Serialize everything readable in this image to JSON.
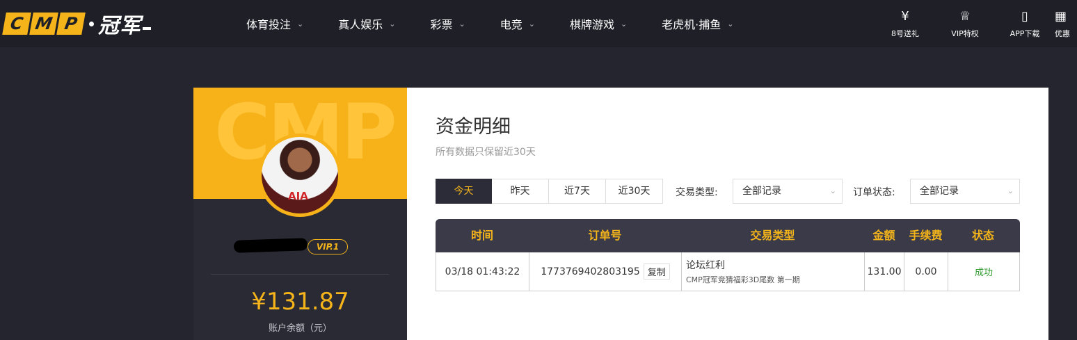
{
  "logo": {
    "letters": [
      "C",
      "M",
      "P"
    ],
    "cn": "冠军"
  },
  "nav": {
    "items": [
      {
        "label": "体育投注"
      },
      {
        "label": "真人娱乐"
      },
      {
        "label": "彩票"
      },
      {
        "label": "电竞"
      },
      {
        "label": "棋牌游戏"
      },
      {
        "label": "老虎机·捕鱼"
      }
    ]
  },
  "right_icons": [
    {
      "label": "8号送礼",
      "icon": "ticket-icon"
    },
    {
      "label": "VIP特权",
      "icon": "crown-icon"
    },
    {
      "label": "APP下载",
      "icon": "phone-icon"
    },
    {
      "label": "优惠",
      "icon": "gift-icon"
    }
  ],
  "profile": {
    "vip": "VIP.1",
    "balance": "¥131.87",
    "balance_label": "账户余额（元）"
  },
  "main": {
    "title": "资金明细",
    "subtitle": "所有数据只保留近30天",
    "date_tabs": [
      "今天",
      "昨天",
      "近7天",
      "近30天"
    ],
    "active_tab": 0,
    "filters": {
      "type_label": "交易类型:",
      "type_value": "全部记录",
      "status_label": "订单状态:",
      "status_value": "全部记录"
    },
    "table": {
      "headers": [
        "时间",
        "订单号",
        "交易类型",
        "金额",
        "手续费",
        "状态"
      ],
      "rows": [
        {
          "time": "03/18 01:43:22",
          "order_no": "1773769402803195",
          "copy_label": "复制",
          "type_main": "论坛红利",
          "type_sub": "CMP冠军竞猜福彩3D尾数 第一期",
          "amount": "131.00",
          "fee": "0.00",
          "status": "成功"
        }
      ]
    }
  },
  "colors": {
    "accent": "#f4b41a",
    "dark": "#25252f",
    "success": "#2e9a2e"
  }
}
